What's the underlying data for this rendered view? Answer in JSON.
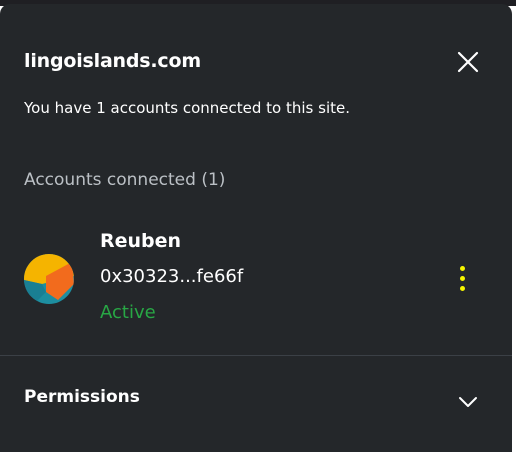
{
  "site": {
    "title": "lingoislands.com",
    "subtitle": "You have 1 accounts connected to this site."
  },
  "accounts_section": {
    "label": "Accounts connected (1)"
  },
  "accounts": [
    {
      "name": "Reuben",
      "address": "0x30323...fe66f",
      "status": "Active"
    }
  ],
  "permissions": {
    "label": "Permissions"
  },
  "icons": {
    "close": "close-icon",
    "menu": "more-vertical-icon",
    "chevron": "chevron-down-icon",
    "avatar": "jazzicon-avatar"
  },
  "colors": {
    "background": "#24272a",
    "text": "#ffffff",
    "muted": "#bbc0c5",
    "active": "#28a745",
    "menu_dots": "#f5f500",
    "divider": "#3b4046"
  }
}
